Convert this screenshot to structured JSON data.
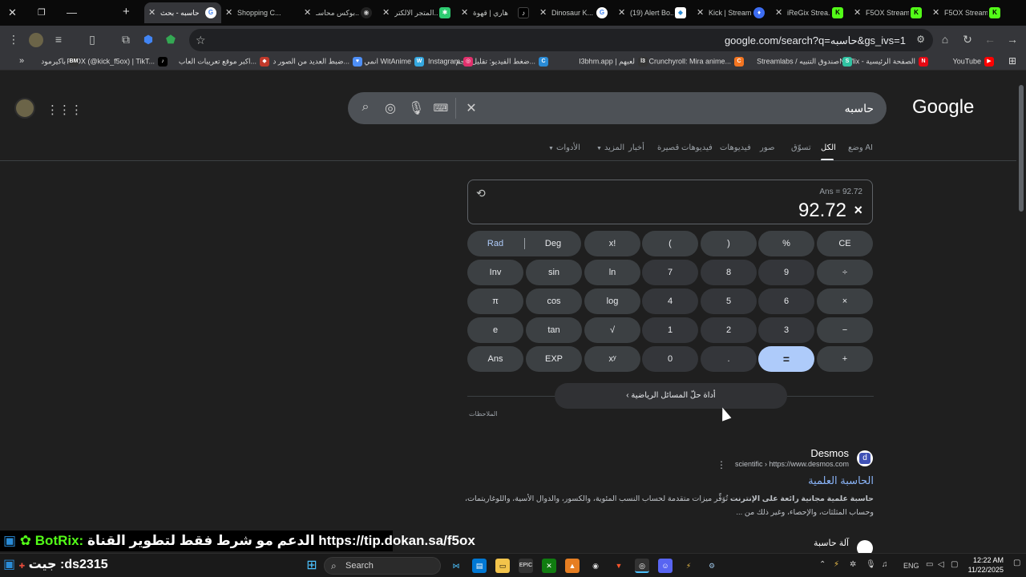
{
  "browser": {
    "tabs": [
      {
        "title": "حاسبه - بحث",
        "fav": "G",
        "cls": "g",
        "active": true
      },
      {
        "title": "Shopping C...",
        "fav": "",
        "cls": "",
        "active": false
      },
      {
        "title": "بوكس محاسـ...",
        "fav": "◉",
        "cls": "bx",
        "active": false
      },
      {
        "title": "المتجر الالكتر...",
        "fav": "✱",
        "cls": "ic",
        "active": false
      },
      {
        "title": "هاري | قهوة",
        "fav": "♪",
        "cls": "tk",
        "active": false
      },
      {
        "title": "Dinosaur K...",
        "fav": "G",
        "cls": "g",
        "active": false
      },
      {
        "title": "(19) Alert Bo...",
        "fav": "◆",
        "cls": "ab",
        "active": false
      },
      {
        "title": "Kick | Stream",
        "fav": "♦",
        "cls": "dg",
        "active": false
      },
      {
        "title": "iReGix Strea...",
        "fav": "K",
        "cls": "k",
        "active": false
      },
      {
        "title": "F5OX Stream",
        "fav": "K",
        "cls": "k",
        "active": false
      },
      {
        "title": "F5OX Stream",
        "fav": "K",
        "cls": "k",
        "active": false
      }
    ],
    "url": "google.com/search?q=حاسبه&gs_ivs=1",
    "bookmarks": [
      {
        "label": "YouTube",
        "color": "#ff0000",
        "icon": "▶"
      },
      {
        "label": "Netflix - الصفحة الرئيسية",
        "color": "#e50914",
        "icon": "N"
      },
      {
        "label": "Streamlabs / صندوق التنبيه",
        "color": "#31c3a2",
        "icon": "S"
      },
      {
        "label": "Crunchyroll: Mira anime...",
        "color": "#f47521",
        "icon": "C"
      },
      {
        "label": "I3bhm.app | لعبهم",
        "color": "#333",
        "icon": "l3"
      },
      {
        "label": "ضغط الفيديو: تقليل حجم...",
        "color": "#2a8bd6",
        "icon": "C"
      },
      {
        "label": "Instagram",
        "color": "#e1306c",
        "icon": "◎"
      },
      {
        "label": "انمي WitAnime",
        "color": "#35a8e0",
        "icon": "W"
      },
      {
        "label": "ضبط العديد من الصور د...",
        "color": "#4e8ff7",
        "icon": "♥"
      },
      {
        "label": "اكبر موقع تعريبات العاب...",
        "color": "#c0392b",
        "icon": "◆"
      },
      {
        "label": "F5OX (@kick_f5ox) | TikT...",
        "color": "#000",
        "icon": "♪"
      },
      {
        "label": "باكيرمود",
        "color": "#333",
        "icon": "BM"
      }
    ]
  },
  "google": {
    "logo": "Google",
    "query": "حاسبه",
    "tabs": [
      "وضع AI",
      "الكل",
      "تسوّق",
      "صور",
      "فيديوهات",
      "فيديوهات قصيرة",
      "أخبار",
      "المزيد",
      "الأدوات"
    ]
  },
  "calculator": {
    "ans_label": "Ans = 92.72",
    "result": "92.72",
    "operator": "×",
    "rad": "Rad",
    "deg": "Deg",
    "keys": [
      [
        "x!",
        "(",
        ")",
        "%",
        "CE"
      ],
      [
        "Inv",
        "sin",
        "ln",
        "7",
        "8",
        "9",
        "÷"
      ],
      [
        "π",
        "cos",
        "log",
        "4",
        "5",
        "6",
        "×"
      ],
      [
        "e",
        "tan",
        "√",
        "1",
        "2",
        "3",
        "−"
      ],
      [
        "Ans",
        "EXP",
        "xʸ",
        "0",
        ".",
        "=",
        "+"
      ]
    ],
    "math_button": "أداة حلّ المسائل الرياضية",
    "notes": "الملاحظات"
  },
  "results": [
    {
      "site": "Desmos",
      "url": "scientific › https://www.desmos.com",
      "title": "الحاسبة العلمية",
      "snippet_bold": "حاسبة علمية مجانية رائعة على الإنترنت",
      "snippet": " تُوَفِّر ميزات متقدمة لحساب النسب المئوية، والكسور، والدوال الأسية، واللوغاريتمات، وحساب المثلثات، والإحصاء، وغير ذلك من ..."
    },
    {
      "site": "آلة حاسبة"
    }
  ],
  "overlay": {
    "botrix": "BotRix:",
    "banner": "الدعم مو شرط فقط لتطوير القناة https://tip.dokan.sa/f5ox",
    "user": "جيت :ds2315"
  },
  "taskbar": {
    "search": "Search",
    "lang": "ENG",
    "time": "12:22 AM",
    "date": "11/22/2025"
  }
}
